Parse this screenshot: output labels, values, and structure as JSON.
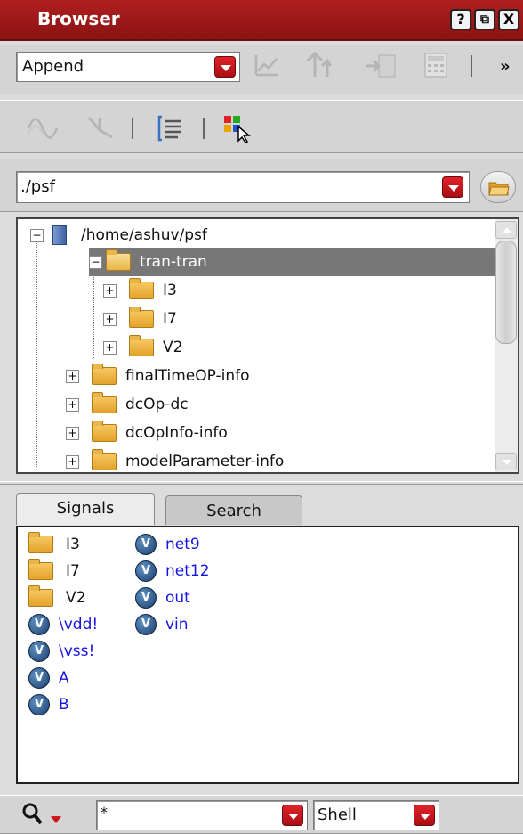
{
  "window": {
    "title": "Browser",
    "buttons": [
      "?",
      "⧉",
      "X"
    ]
  },
  "toolbar1": {
    "mode_value": "Append",
    "more_label": "»"
  },
  "path": {
    "value": "./psf"
  },
  "tree": {
    "root": "/home/ashuv/psf",
    "items": [
      {
        "label": "tran-tran",
        "selected": true
      },
      {
        "label": "I3"
      },
      {
        "label": "I7"
      },
      {
        "label": "V2"
      },
      {
        "label": "finalTimeOP-info"
      },
      {
        "label": "dcOp-dc"
      },
      {
        "label": "dcOpInfo-info"
      },
      {
        "label": "modelParameter-info"
      }
    ]
  },
  "tabs": {
    "signals": "Signals",
    "search": "Search"
  },
  "signals": {
    "col1": [
      {
        "label": "I3",
        "kind": "folder"
      },
      {
        "label": "I7",
        "kind": "folder"
      },
      {
        "label": "V2",
        "kind": "folder"
      },
      {
        "label": "\\vdd!",
        "kind": "signal"
      },
      {
        "label": "\\vss!",
        "kind": "signal"
      },
      {
        "label": "A",
        "kind": "signal"
      },
      {
        "label": "B",
        "kind": "signal"
      }
    ],
    "col2": [
      {
        "label": "net9",
        "kind": "signal"
      },
      {
        "label": "net12",
        "kind": "signal"
      },
      {
        "label": "out",
        "kind": "signal"
      },
      {
        "label": "vin",
        "kind": "signal"
      }
    ]
  },
  "bottom": {
    "filter_value": "*",
    "syntax_value": "Shell"
  },
  "colors": {
    "title_bar": "#9a1818",
    "accent": "#c8141b",
    "selection": "#777777",
    "signal_text": "#1515e6"
  }
}
